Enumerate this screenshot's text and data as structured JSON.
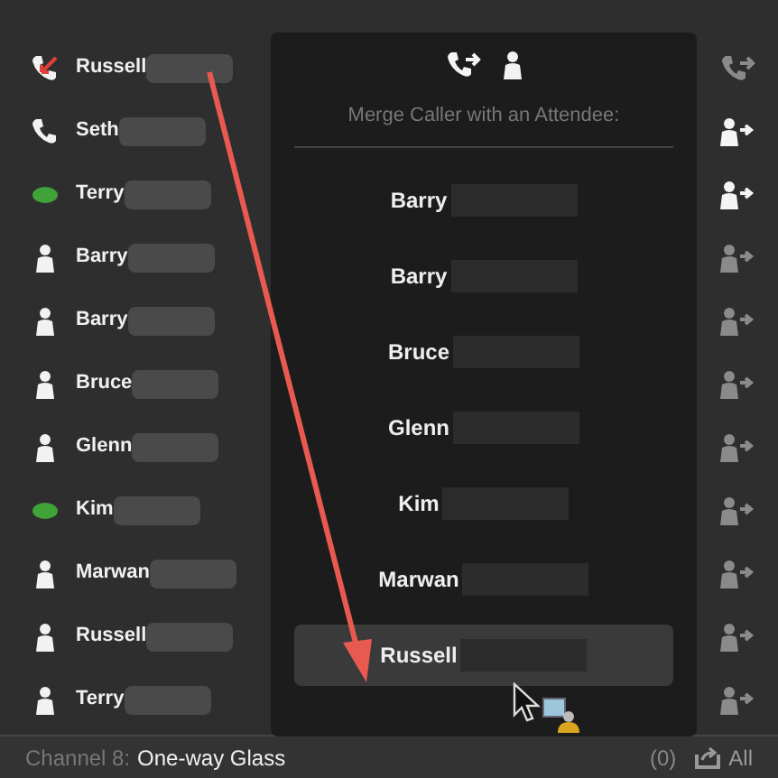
{
  "contacts": [
    {
      "name": "Russell",
      "kind": "missed-call",
      "action": {
        "kind": "transfer-call",
        "enabled": false
      }
    },
    {
      "name": "Seth",
      "kind": "call",
      "action": {
        "kind": "add-attendee",
        "enabled": true
      }
    },
    {
      "name": "Terry",
      "kind": "chat",
      "action": {
        "kind": "add-attendee",
        "enabled": true
      }
    },
    {
      "name": "Barry",
      "kind": "person",
      "action": {
        "kind": "add-attendee",
        "enabled": false
      }
    },
    {
      "name": "Barry",
      "kind": "person",
      "action": {
        "kind": "add-attendee",
        "enabled": false
      }
    },
    {
      "name": "Bruce",
      "kind": "person",
      "action": {
        "kind": "add-attendee",
        "enabled": false
      }
    },
    {
      "name": "Glenn",
      "kind": "person",
      "action": {
        "kind": "add-attendee",
        "enabled": false
      }
    },
    {
      "name": "Kim",
      "kind": "chat",
      "action": {
        "kind": "add-attendee",
        "enabled": false
      }
    },
    {
      "name": "Marwan",
      "kind": "person",
      "action": {
        "kind": "add-attendee",
        "enabled": false
      }
    },
    {
      "name": "Russell",
      "kind": "person",
      "action": {
        "kind": "add-attendee",
        "enabled": false
      }
    },
    {
      "name": "Terry",
      "kind": "person",
      "action": {
        "kind": "add-attendee",
        "enabled": false
      }
    }
  ],
  "merge_panel": {
    "title": "Merge Caller with an Attendee:",
    "attendees": [
      {
        "name": "Barry",
        "selected": false
      },
      {
        "name": "Barry",
        "selected": false
      },
      {
        "name": "Bruce",
        "selected": false
      },
      {
        "name": "Glenn",
        "selected": false
      },
      {
        "name": "Kim",
        "selected": false
      },
      {
        "name": "Marwan",
        "selected": false
      },
      {
        "name": "Russell",
        "selected": true
      }
    ]
  },
  "footer": {
    "channel_label": "Channel 8:",
    "channel_name": "One-way Glass",
    "count": "(0)",
    "filter": "All"
  }
}
